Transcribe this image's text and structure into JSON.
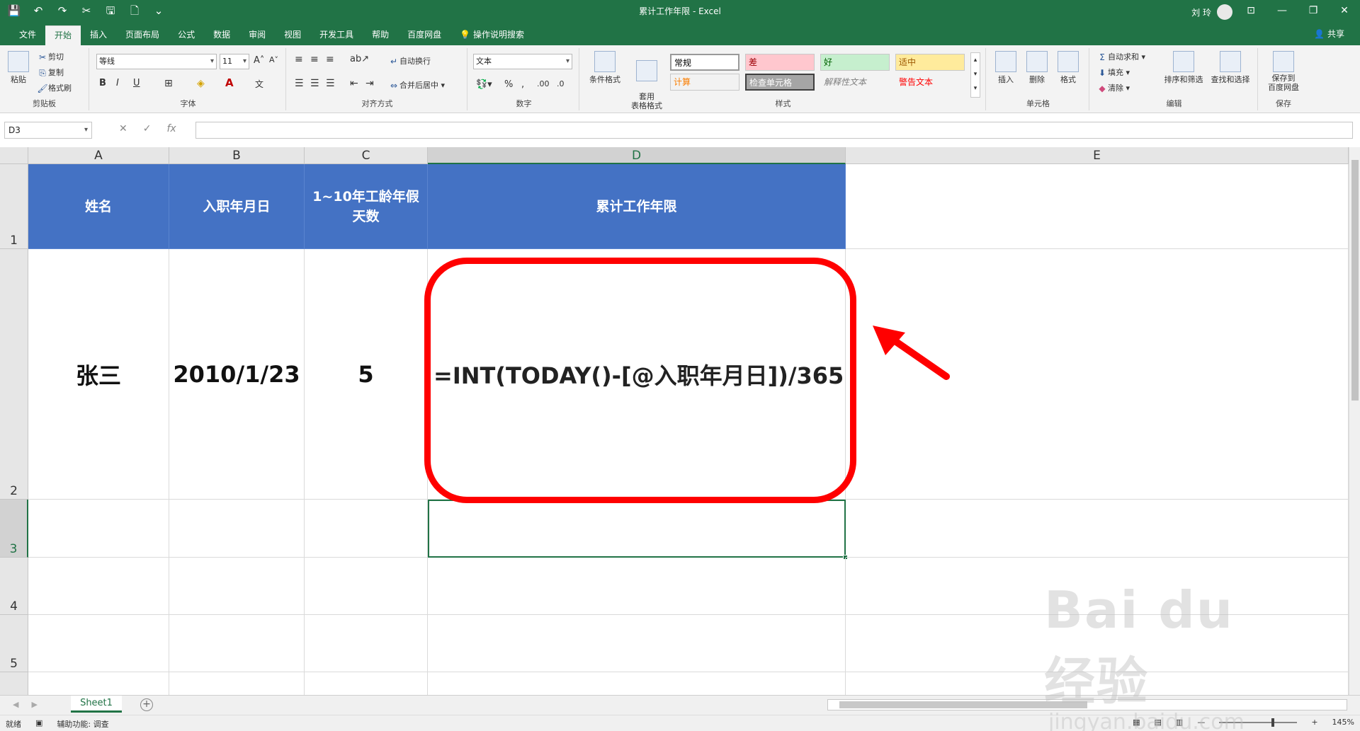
{
  "window": {
    "title": "累计工作年限  -  Excel",
    "user": "刘 玲",
    "controls": [
      "⊡",
      "—",
      "❐",
      "✕"
    ]
  },
  "qat": [
    "💾",
    "↶",
    "↷",
    "✂",
    "🖫",
    "🗋",
    "⌄"
  ],
  "tabs": [
    "文件",
    "开始",
    "插入",
    "页面布局",
    "公式",
    "数据",
    "审阅",
    "视图",
    "开发工具",
    "帮助",
    "百度网盘",
    "操作说明搜索"
  ],
  "share": "共享",
  "ribbon": {
    "clipboard": {
      "title": "剪贴板",
      "paste": "粘贴",
      "cut": "剪切",
      "copy": "复制",
      "format_painter": "格式刷"
    },
    "font": {
      "title": "字体",
      "name": "等线",
      "size": "11",
      "bold": "B",
      "italic": "I",
      "underline": "U"
    },
    "alignment": {
      "title": "对齐方式",
      "wrap": "自动换行",
      "merge": "合并后居中"
    },
    "number": {
      "title": "数字",
      "format": "文本",
      "percent": "%",
      "comma": ","
    },
    "styles": {
      "title": "样式",
      "conditional": "条件格式",
      "table": "套用\n表格格式",
      "cells": [
        {
          "label": "常规",
          "bg": "#ffffff",
          "fg": "#000000"
        },
        {
          "label": "差",
          "bg": "#ffc7ce",
          "fg": "#9c0006"
        },
        {
          "label": "好",
          "bg": "#c6efce",
          "fg": "#006100"
        },
        {
          "label": "适中",
          "bg": "#ffeb9c",
          "fg": "#9c5700"
        },
        {
          "label": "计算",
          "bg": "#f2f2f2",
          "fg": "#fa7d00"
        },
        {
          "label": "检查单元格",
          "bg": "#a5a5a5",
          "fg": "#ffffff"
        },
        {
          "label": "解释性文本",
          "bg": "#f3f3f3",
          "fg": "#7f7f7f"
        },
        {
          "label": "警告文本",
          "bg": "#f3f3f3",
          "fg": "#ff0000"
        }
      ]
    },
    "cells": {
      "title": "单元格",
      "insert": "插入",
      "delete": "删除",
      "format": "格式"
    },
    "editing": {
      "title": "编辑",
      "autosum": "自动求和",
      "fill": "填充",
      "clear": "清除",
      "sort": "排序和筛选",
      "find": "查找和选择"
    },
    "save": {
      "title": "保存",
      "baidu": "保存到\n百度网盘"
    }
  },
  "formula_bar": {
    "name_box": "D3",
    "cancel": "✕",
    "enter": "✓",
    "fx": "fx",
    "content": ""
  },
  "sheet": {
    "columns": [
      "A",
      "B",
      "C",
      "D",
      "E"
    ],
    "rows": [
      "1",
      "2",
      "3",
      "4",
      "5"
    ],
    "header_row": [
      "姓名",
      "入职年月日",
      "1~10年工龄年假\n天数",
      "累计工作年限"
    ],
    "data_row": [
      "张三",
      "2010/1/23",
      "5",
      "=INT(TODAY()-[@入职年月日])/365)"
    ],
    "header_bg": "#4472c4",
    "selected_column": "D",
    "selected_row": "3"
  },
  "annotation_color": "#ff0000",
  "sheet_tabs": [
    "Sheet1"
  ],
  "status": {
    "ready": "就绪",
    "accessibility": "辅助功能: 调查",
    "zoom": "145%"
  },
  "watermark": {
    "brand": "Bai du经验",
    "url": "jingyan.baidu.com"
  }
}
